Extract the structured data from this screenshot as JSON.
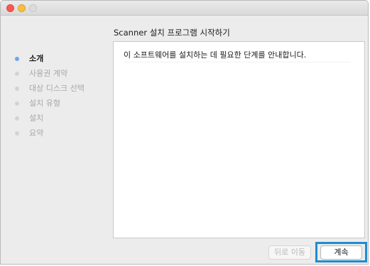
{
  "window": {
    "controls": {
      "close": "close-icon",
      "minimize": "minimize-icon",
      "zoom": "zoom-icon"
    }
  },
  "heading": "Scanner 설치 프로그램 시작하기",
  "steps": [
    {
      "label": "소개",
      "active": true
    },
    {
      "label": "사용권 계약",
      "active": false
    },
    {
      "label": "대상 디스크 선택",
      "active": false
    },
    {
      "label": "설치 유형",
      "active": false
    },
    {
      "label": "설치",
      "active": false
    },
    {
      "label": "요약",
      "active": false
    }
  ],
  "content": {
    "intro": "이 소프트웨어를 설치하는 데 필요한 단계를 안내합니다."
  },
  "buttons": {
    "back": "뒤로 이동",
    "continue": "계속"
  },
  "colors": {
    "active_step_bullet": "#6fa6e6",
    "focus_ring": "#1f8ccf",
    "close": "#fc5753",
    "minimize": "#fdbc40"
  }
}
